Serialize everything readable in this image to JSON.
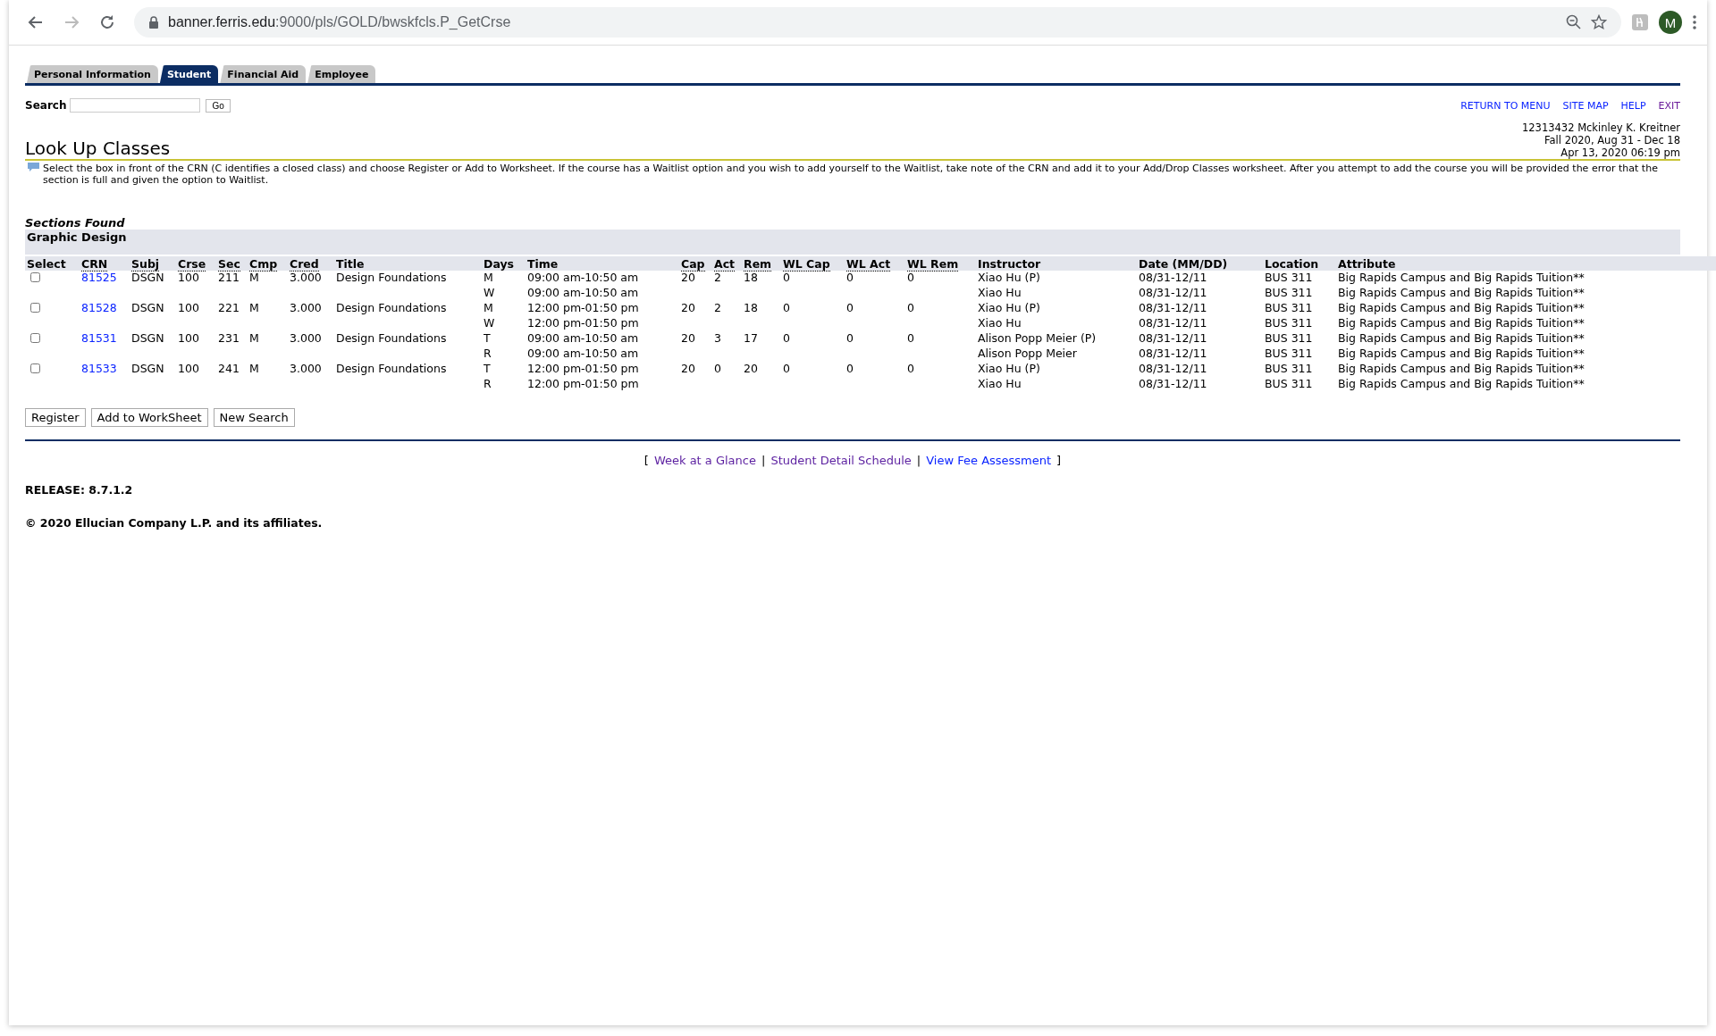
{
  "browser": {
    "url_host": "banner.ferris.edu",
    "url_path": ":9000/pls/GOLD/bwskfcls.P_GetCrse",
    "profile_initial": "M"
  },
  "tabs": [
    {
      "label": "Personal Information",
      "selected": false
    },
    {
      "label": "Student",
      "selected": true
    },
    {
      "label": "Financial Aid",
      "selected": false
    },
    {
      "label": "Employee",
      "selected": false
    }
  ],
  "search": {
    "label": "Search",
    "button": "Go"
  },
  "menu_links": [
    {
      "label": "RETURN TO MENU",
      "visited": false
    },
    {
      "label": "SITE MAP",
      "visited": false
    },
    {
      "label": "HELP",
      "visited": false
    },
    {
      "label": "EXIT",
      "visited": true
    }
  ],
  "page_title": "Look Up Classes",
  "user_info": [
    "12313432 Mckinley K. Kreitner",
    "Fall 2020, Aug 31 - Dec 18",
    "Apr 13, 2020 06:19 pm"
  ],
  "instructions": "Select the box in front of the CRN (C identifies a closed class) and choose Register or Add to Worksheet. If the course has a Waitlist option and you wish to add yourself to the Waitlist, take note of the CRN and add it to your Add/Drop Classes worksheet. After you attempt to add the course you will be provided the error that the section is full and given the option to Waitlist.",
  "sections_caption": "Sections Found",
  "subject_heading": "Graphic Design",
  "table": {
    "columns": [
      {
        "label": "Select",
        "abbr": false
      },
      {
        "label": "CRN",
        "abbr": true
      },
      {
        "label": "Subj",
        "abbr": true
      },
      {
        "label": "Crse",
        "abbr": true
      },
      {
        "label": "Sec",
        "abbr": true
      },
      {
        "label": "Cmp",
        "abbr": true
      },
      {
        "label": "Cred",
        "abbr": true
      },
      {
        "label": "Title",
        "abbr": false
      },
      {
        "label": "Days",
        "abbr": false
      },
      {
        "label": "Time",
        "abbr": false
      },
      {
        "label": "Cap",
        "abbr": true
      },
      {
        "label": "Act",
        "abbr": true
      },
      {
        "label": "Rem",
        "abbr": true
      },
      {
        "label": "WL Cap",
        "abbr": true
      },
      {
        "label": "WL Act",
        "abbr": true
      },
      {
        "label": "WL Rem",
        "abbr": true
      },
      {
        "label": "Instructor",
        "abbr": false
      },
      {
        "label": "Date (MM/DD)",
        "abbr": false
      },
      {
        "label": "Location",
        "abbr": false
      },
      {
        "label": "Attribute",
        "abbr": false
      }
    ],
    "sections": [
      {
        "checked": false,
        "crn": "81525",
        "subj": "DSGN",
        "crse": "100",
        "sec": "211",
        "cmp": "M",
        "cred": "3.000",
        "title": "Design Foundations",
        "cap": "20",
        "act": "2",
        "rem": "18",
        "wl_cap": "0",
        "wl_act": "0",
        "wl_rem": "0",
        "meetings": [
          {
            "days": "M",
            "time": "09:00 am-10:50 am",
            "instructor": "Xiao Hu (P)",
            "date": "08/31-12/11",
            "location": "BUS 311",
            "attribute": "Big Rapids Campus and Big Rapids Tuition**"
          },
          {
            "days": "W",
            "time": "09:00 am-10:50 am",
            "instructor": "Xiao Hu",
            "date": "08/31-12/11",
            "location": "BUS 311",
            "attribute": "Big Rapids Campus and Big Rapids Tuition**"
          }
        ]
      },
      {
        "checked": false,
        "crn": "81528",
        "subj": "DSGN",
        "crse": "100",
        "sec": "221",
        "cmp": "M",
        "cred": "3.000",
        "title": "Design Foundations",
        "cap": "20",
        "act": "2",
        "rem": "18",
        "wl_cap": "0",
        "wl_act": "0",
        "wl_rem": "0",
        "meetings": [
          {
            "days": "M",
            "time": "12:00 pm-01:50 pm",
            "instructor": "Xiao Hu (P)",
            "date": "08/31-12/11",
            "location": "BUS 311",
            "attribute": "Big Rapids Campus and Big Rapids Tuition**"
          },
          {
            "days": "W",
            "time": "12:00 pm-01:50 pm",
            "instructor": "Xiao Hu",
            "date": "08/31-12/11",
            "location": "BUS 311",
            "attribute": "Big Rapids Campus and Big Rapids Tuition**"
          }
        ]
      },
      {
        "checked": false,
        "crn": "81531",
        "subj": "DSGN",
        "crse": "100",
        "sec": "231",
        "cmp": "M",
        "cred": "3.000",
        "title": "Design Foundations",
        "cap": "20",
        "act": "3",
        "rem": "17",
        "wl_cap": "0",
        "wl_act": "0",
        "wl_rem": "0",
        "meetings": [
          {
            "days": "T",
            "time": "09:00 am-10:50 am",
            "instructor": "Alison Popp Meier (P)",
            "date": "08/31-12/11",
            "location": "BUS 311",
            "attribute": "Big Rapids Campus and Big Rapids Tuition**"
          },
          {
            "days": "R",
            "time": "09:00 am-10:50 am",
            "instructor": "Alison Popp Meier",
            "date": "08/31-12/11",
            "location": "BUS 311",
            "attribute": "Big Rapids Campus and Big Rapids Tuition**"
          }
        ]
      },
      {
        "checked": false,
        "crn": "81533",
        "subj": "DSGN",
        "crse": "100",
        "sec": "241",
        "cmp": "M",
        "cred": "3.000",
        "title": "Design Foundations",
        "cap": "20",
        "act": "0",
        "rem": "20",
        "wl_cap": "0",
        "wl_act": "0",
        "wl_rem": "0",
        "meetings": [
          {
            "days": "T",
            "time": "12:00 pm-01:50 pm",
            "instructor": "Xiao Hu (P)",
            "date": "08/31-12/11",
            "location": "BUS 311",
            "attribute": "Big Rapids Campus and Big Rapids Tuition**"
          },
          {
            "days": "R",
            "time": "12:00 pm-01:50 pm",
            "instructor": "Xiao Hu",
            "date": "08/31-12/11",
            "location": "BUS 311",
            "attribute": "Big Rapids Campus and Big Rapids Tuition**"
          }
        ]
      }
    ]
  },
  "buttons": [
    "Register",
    "Add to WorkSheet",
    "New Search"
  ],
  "footer_links": {
    "open": "[",
    "separator": "|",
    "close": "]",
    "links": [
      {
        "label": "Week at a Glance",
        "visited": true
      },
      {
        "label": "Student Detail Schedule",
        "visited": true
      },
      {
        "label": "View Fee Assessment",
        "visited": false
      }
    ]
  },
  "release": "RELEASE: 8.7.1.2",
  "copyright": "© 2020 Ellucian Company L.P. and its affiliates."
}
